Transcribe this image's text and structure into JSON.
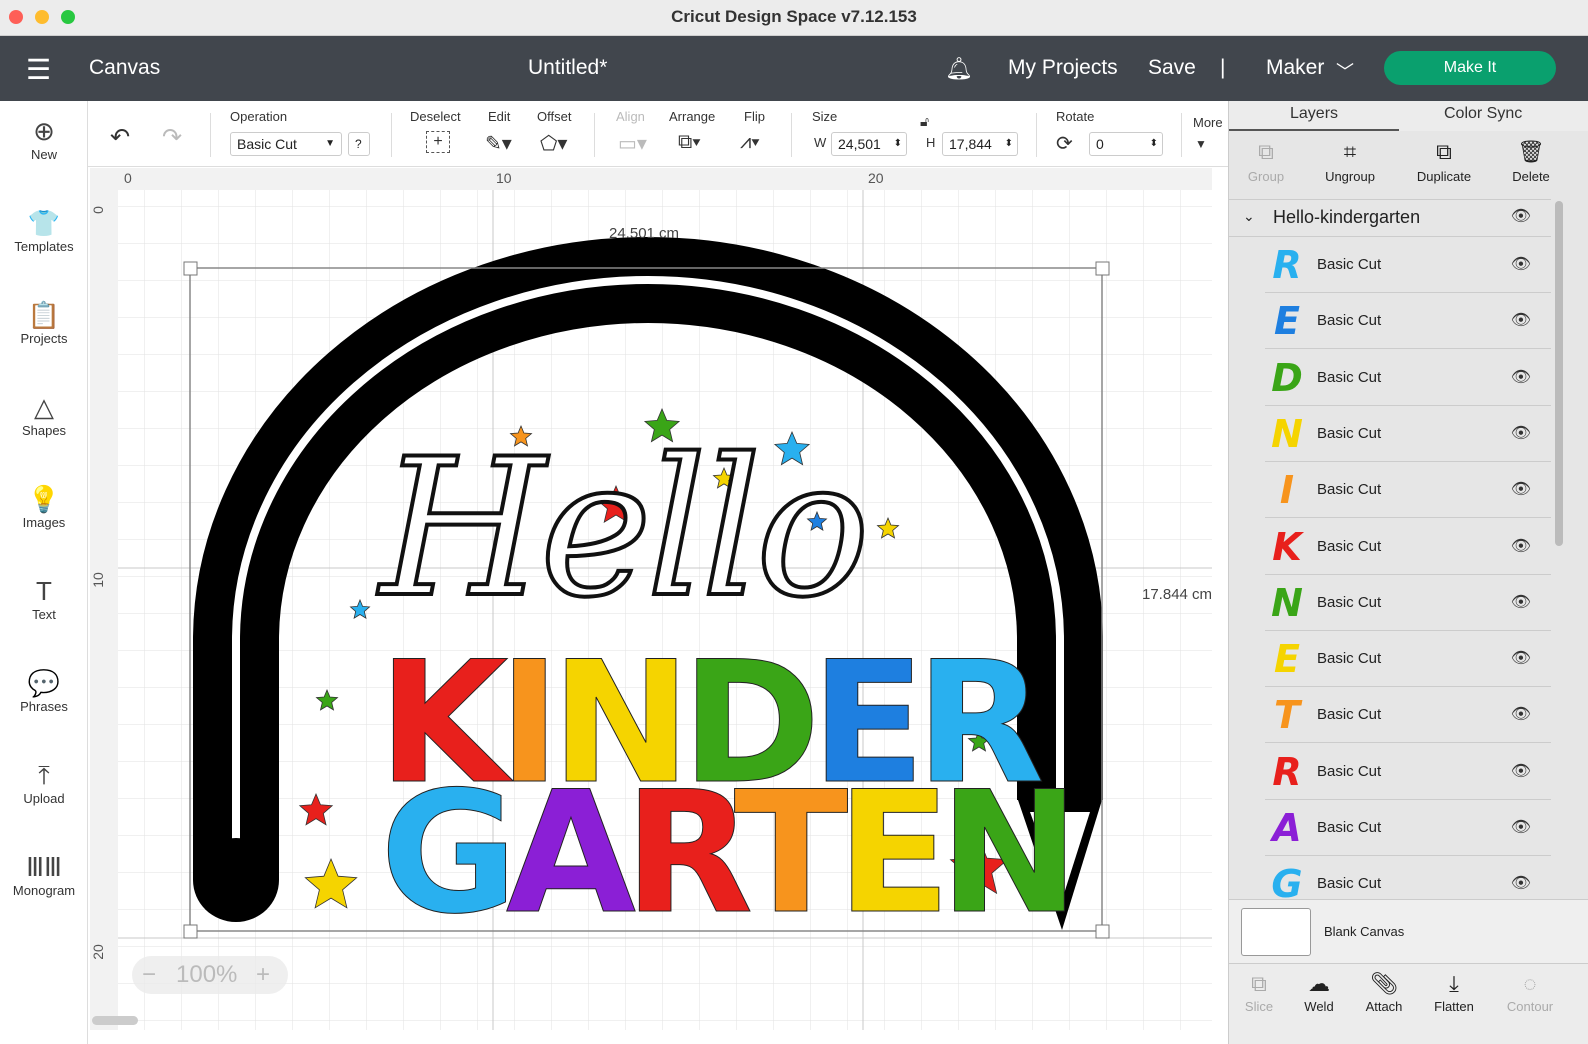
{
  "window": {
    "title": "Cricut Design Space  v7.12.153"
  },
  "header": {
    "section": "Canvas",
    "doc_title": "Untitled*",
    "my_projects": "My Projects",
    "save": "Save",
    "divider": "|",
    "machine": "Maker",
    "make_it": "Make It"
  },
  "leftbar": [
    {
      "label": "New",
      "icon": "plus-circle-icon",
      "glyph": "⊕"
    },
    {
      "label": "Templates",
      "icon": "tshirt-icon",
      "glyph": "👕"
    },
    {
      "label": "Projects",
      "icon": "clipboard-icon",
      "glyph": "📋"
    },
    {
      "label": "Shapes",
      "icon": "shapes-icon",
      "glyph": "△"
    },
    {
      "label": "Images",
      "icon": "lightbulb-icon",
      "glyph": "💡"
    },
    {
      "label": "Text",
      "icon": "text-icon",
      "glyph": "T"
    },
    {
      "label": "Phrases",
      "icon": "speech-bubble-icon",
      "glyph": "💬"
    },
    {
      "label": "Upload",
      "icon": "upload-icon",
      "glyph": "⤒"
    },
    {
      "label": "Monogram",
      "icon": "monogram-icon",
      "glyph": "ⅢⅢ"
    }
  ],
  "toolbar": {
    "operation_label": "Operation",
    "operation_value": "Basic Cut",
    "help": "?",
    "deselect": "Deselect",
    "edit": "Edit",
    "offset": "Offset",
    "align": "Align",
    "arrange": "Arrange",
    "flip": "Flip",
    "size": "Size",
    "w_label": "W",
    "w_value": "24,501",
    "h_label": "H",
    "h_value": "17,844",
    "rotate": "Rotate",
    "rotate_value": "0",
    "more": "More"
  },
  "canvas": {
    "ruler_top": [
      "0",
      "10",
      "20"
    ],
    "ruler_left": [
      "0",
      "10",
      "20"
    ],
    "width_dim": "24.501 cm",
    "height_dim": "17.844 cm",
    "zoom": "100%",
    "zoom_minus": "−",
    "zoom_plus": "+"
  },
  "artwork": {
    "hello": "Hello",
    "line1": [
      {
        "ch": "K",
        "color": "#e8201c"
      },
      {
        "ch": "I",
        "color": "#f7941d"
      },
      {
        "ch": "N",
        "color": "#f5d400"
      },
      {
        "ch": "D",
        "color": "#3aa517"
      },
      {
        "ch": "E",
        "color": "#1e7fe0"
      },
      {
        "ch": "R",
        "color": "#29b0ef"
      }
    ],
    "line2": [
      {
        "ch": "G",
        "color": "#29b0ef"
      },
      {
        "ch": "A",
        "color": "#8b1fd6"
      },
      {
        "ch": "R",
        "color": "#e8201c"
      },
      {
        "ch": "T",
        "color": "#f7941d"
      },
      {
        "ch": "E",
        "color": "#f5d400"
      },
      {
        "ch": "N",
        "color": "#3aa517"
      }
    ]
  },
  "panel": {
    "tabs": [
      "Layers",
      "Color Sync"
    ],
    "actions": [
      "Group",
      "Ungroup",
      "Duplicate",
      "Delete"
    ],
    "group_name": "Hello-kindergarten",
    "layers": [
      {
        "ch": "R",
        "color": "#29b0ef",
        "name": "Basic Cut"
      },
      {
        "ch": "E",
        "color": "#1e7fe0",
        "name": "Basic Cut"
      },
      {
        "ch": "D",
        "color": "#3aa517",
        "name": "Basic Cut"
      },
      {
        "ch": "N",
        "color": "#f5d400",
        "name": "Basic Cut"
      },
      {
        "ch": "I",
        "color": "#f7941d",
        "name": "Basic Cut"
      },
      {
        "ch": "K",
        "color": "#e8201c",
        "name": "Basic Cut"
      },
      {
        "ch": "N",
        "color": "#3aa517",
        "name": "Basic Cut"
      },
      {
        "ch": "E",
        "color": "#f5d400",
        "name": "Basic Cut"
      },
      {
        "ch": "T",
        "color": "#f7941d",
        "name": "Basic Cut"
      },
      {
        "ch": "R",
        "color": "#e8201c",
        "name": "Basic Cut"
      },
      {
        "ch": "A",
        "color": "#8b1fd6",
        "name": "Basic Cut"
      },
      {
        "ch": "G",
        "color": "#29b0ef",
        "name": "Basic Cut"
      }
    ],
    "blank_canvas": "Blank Canvas",
    "bottom_actions": [
      "Slice",
      "Weld",
      "Attach",
      "Flatten",
      "Contour"
    ]
  }
}
